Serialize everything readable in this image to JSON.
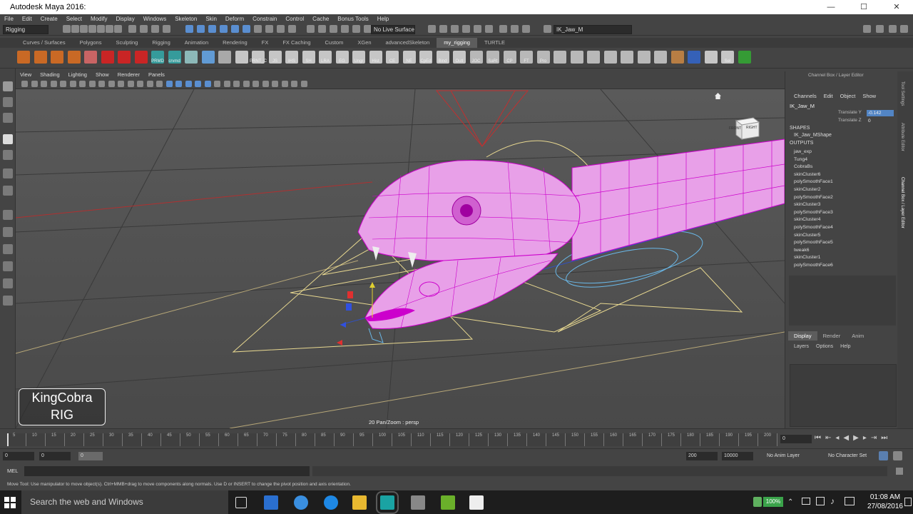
{
  "window": {
    "title": "Autodesk Maya 2016:",
    "min": "—",
    "max": "☐",
    "close": "✕"
  },
  "menubar": [
    "File",
    "Edit",
    "Create",
    "Select",
    "Modify",
    "Display",
    "Windows",
    "Skeleton",
    "Skin",
    "Deform",
    "Constrain",
    "Control",
    "Cache",
    "Bonus Tools",
    "Help"
  ],
  "statusline": {
    "mode": "Rigging",
    "live_surface": "No Live Surface",
    "object_name": "IK_Jaw_M"
  },
  "shelf_tabs": [
    "Curves / Surfaces",
    "Polygons",
    "Sculpting",
    "Rigging",
    "Animation",
    "Rendering",
    "FX",
    "FX Caching",
    "Custom",
    "XGen",
    "advancedSkeleton",
    "my_rigging",
    "TURTLE"
  ],
  "shelf_active_tab": "my_rigging",
  "shelf_labels": [
    "PRMD",
    "crvmd",
    "PRNT_C",
    "JS",
    "IHS",
    "SH",
    "LRA",
    "EG",
    "Ungr",
    "Hist",
    "CE",
    "NE",
    "CpEd",
    "Bind",
    "Outl",
    "JOC",
    "SaRt",
    "CP",
    "FT",
    "Pro",
    "Sel"
  ],
  "panel_menu": [
    "View",
    "Shading",
    "Lighting",
    "Show",
    "Renderer",
    "Panels"
  ],
  "viewport": {
    "hud": "20 Pan/Zoom : persp",
    "logo_line1": "KingCobra",
    "logo_line2": "RIG",
    "viewcube_front": "FRONT",
    "viewcube_right": "RIGHT"
  },
  "channel_box": {
    "title": "Channel Box / Layer Editor",
    "menu": [
      "Channels",
      "Edit",
      "Object",
      "Show"
    ],
    "object": "IK_Jaw_M",
    "attributes": [
      {
        "name": "Translate Y",
        "value": "-0.142"
      },
      {
        "name": "Translate Z",
        "value": "0"
      }
    ],
    "shapes_header": "SHAPES",
    "shape": "IK_Jaw_MShape",
    "outputs_header": "OUTPUTS",
    "outputs": [
      "jaw_exp",
      "Tung4",
      "CobraBs",
      "skinCluster6",
      "polySmoothFace1",
      "skinCluster2",
      "polySmoothFace2",
      "skinCluster3",
      "polySmoothFace3",
      "skinCluster4",
      "polySmoothFace4",
      "skinCluster5",
      "polySmoothFace5",
      "tweak6",
      "skinCluster1",
      "polySmoothFace6"
    ]
  },
  "layer_editor": {
    "tabs": [
      "Display",
      "Render",
      "Anim"
    ],
    "active_tab": "Display",
    "menu": [
      "Layers",
      "Options",
      "Help"
    ]
  },
  "side_tabs": [
    "Tool Settings",
    "Attribute Editor",
    "Channel Box / Layer Editor"
  ],
  "timeline": {
    "ticks": [
      "5",
      "10",
      "15",
      "20",
      "25",
      "30",
      "35",
      "40",
      "45",
      "50",
      "55",
      "60",
      "65",
      "70",
      "75",
      "80",
      "85",
      "90",
      "95",
      "100",
      "105",
      "110",
      "115",
      "120",
      "125",
      "130",
      "135",
      "140",
      "145",
      "150",
      "155",
      "160",
      "165",
      "170",
      "175",
      "180",
      "185",
      "190",
      "195",
      "200"
    ],
    "current_frame": "0"
  },
  "range": {
    "start": "0",
    "inner_start": "0",
    "handle": "0",
    "end": "200",
    "outer_end": "10000",
    "anim_layer": "No Anim Layer",
    "character_set": "No Character Set"
  },
  "command_line": {
    "label": "MEL"
  },
  "help_line": "Move Tool: Use manipulator to move object(s). Ctrl+MMB+drag to move components along normals. Use D or INSERT to change the pivot position and axis orientation.",
  "taskbar": {
    "search_placeholder": "Search the web and Windows",
    "battery": "100%",
    "time": "01:08 AM",
    "date": "27/08/2016"
  },
  "colors": {
    "viewport_bg": "#555555",
    "mesh": "#e080e0",
    "mesh_wire": "#cc00cc",
    "control_yellow": "#e8d890",
    "control_blue": "#6ab8e8",
    "control_red": "#c03030",
    "selected_value": "#5285c5"
  }
}
